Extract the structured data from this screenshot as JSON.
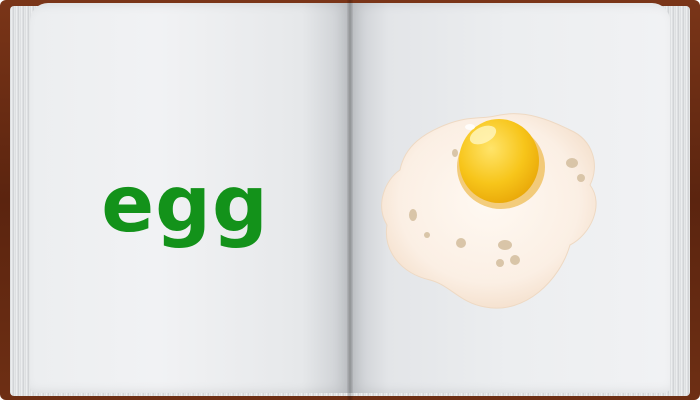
{
  "page": {
    "word": "egg",
    "word_color": "#13921a",
    "illustration": "fried-egg"
  },
  "colors": {
    "book_cover": "#6a2c12",
    "page": "#eef0f2",
    "egg_white": "#fbefe4",
    "yolk": "#f6c21b"
  }
}
